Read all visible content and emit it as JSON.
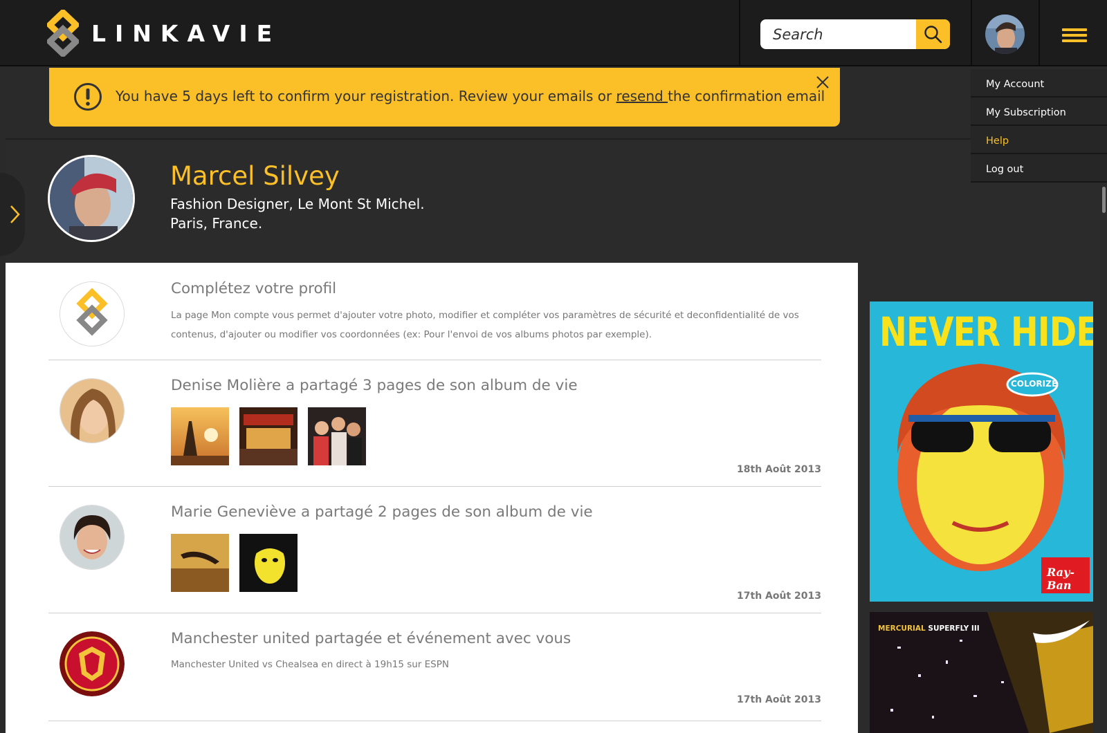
{
  "header": {
    "logo_text": "LINKAVIE",
    "search": {
      "placeholder": "Search"
    }
  },
  "notice": {
    "text_before": "You have 5 days left to confirm your registration. Review your emails or ",
    "link_text": "resend ",
    "text_after": "the confirmation email"
  },
  "user_menu": {
    "items": [
      {
        "label": "My Account"
      },
      {
        "label": "My Subscription"
      },
      {
        "label": "Help",
        "active": true
      },
      {
        "label": "Log out"
      }
    ]
  },
  "profile": {
    "name": "Marcel Silvey",
    "occupation": "Fashion Designer, Le Mont St Michel.",
    "location": "Paris, France."
  },
  "feed": [
    {
      "title": "Complétez votre profil",
      "description": "La page Mon compte  vous permet d'ajouter votre photo, modifier et compléter vos paramètres de sécurité et deconfidentialité de vos contenus, d'ajouter ou modifier vos coordonnées (ex: Pour l'envoi de vos albums photos par exemple)."
    },
    {
      "title": "Denise Molière a partagé 3 pages de son album de vie",
      "date": "18th Août 2013"
    },
    {
      "title": "Marie Geneviève a partagé 2 pages de son album de vie",
      "date": "17th Août 2013"
    },
    {
      "title": "Manchester united partagée et événement avec vous",
      "description": "Manchester United vs Chealsea en direct à 19h15 sur ESPN",
      "date": "17th Août 2013"
    }
  ],
  "ads": {
    "ad1": {
      "headline": "NEVER HIDE",
      "tag": "COLORIZE",
      "brand": "Ray-Ban"
    },
    "ad2": {
      "line1": "MERCURIAL",
      "line2": "SUPERFLY III"
    }
  },
  "colors": {
    "accent": "#fbbf27",
    "dark": "#1c1c1c",
    "panel": "#2b2b2b"
  }
}
